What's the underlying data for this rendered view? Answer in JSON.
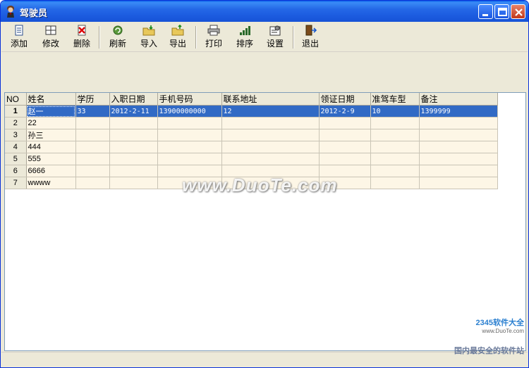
{
  "window": {
    "title": "驾驶员",
    "icon": "driver-app-icon",
    "controls": [
      "minimize",
      "maximize",
      "close"
    ]
  },
  "toolbar": {
    "add": "添加",
    "edit": "修改",
    "delete": "删除",
    "refresh": "刷新",
    "import": "导入",
    "export": "导出",
    "print": "打印",
    "sort": "排序",
    "settings": "设置",
    "exit": "退出"
  },
  "grid": {
    "columns": [
      "NO",
      "姓名",
      "学历",
      "入职日期",
      "手机号码",
      "联系地址",
      "领证日期",
      "准驾车型",
      "备注"
    ],
    "rows": [
      {
        "no": "1",
        "cells": [
          "赵一",
          "33",
          "2012-2-11",
          "13900000000",
          "12",
          "2012-2-9",
          "10",
          "1399999"
        ],
        "selected": true
      },
      {
        "no": "2",
        "cells": [
          "22",
          "",
          "",
          "",
          "",
          "",
          "",
          ""
        ]
      },
      {
        "no": "3",
        "cells": [
          "孙三",
          "",
          "",
          "",
          "",
          "",
          "",
          ""
        ]
      },
      {
        "no": "4",
        "cells": [
          "444",
          "",
          "",
          "",
          "",
          "",
          "",
          ""
        ]
      },
      {
        "no": "5",
        "cells": [
          "555",
          "",
          "",
          "",
          "",
          "",
          "",
          ""
        ]
      },
      {
        "no": "6",
        "cells": [
          "6666",
          "",
          "",
          "",
          "",
          "",
          "",
          ""
        ]
      },
      {
        "no": "7",
        "cells": [
          "wwww",
          "",
          "",
          "",
          "",
          "",
          "",
          ""
        ]
      }
    ]
  },
  "watermarks": {
    "center": "www.DuoTe.com",
    "corner_brand": "2345软件大全",
    "corner_url": "www.DuoTe.com",
    "corner_slogan": "国内最安全的软件站"
  },
  "colors": {
    "selection": "#316ac5",
    "cell_background": "#fdf6e6",
    "titlebar": "#2468e6"
  }
}
